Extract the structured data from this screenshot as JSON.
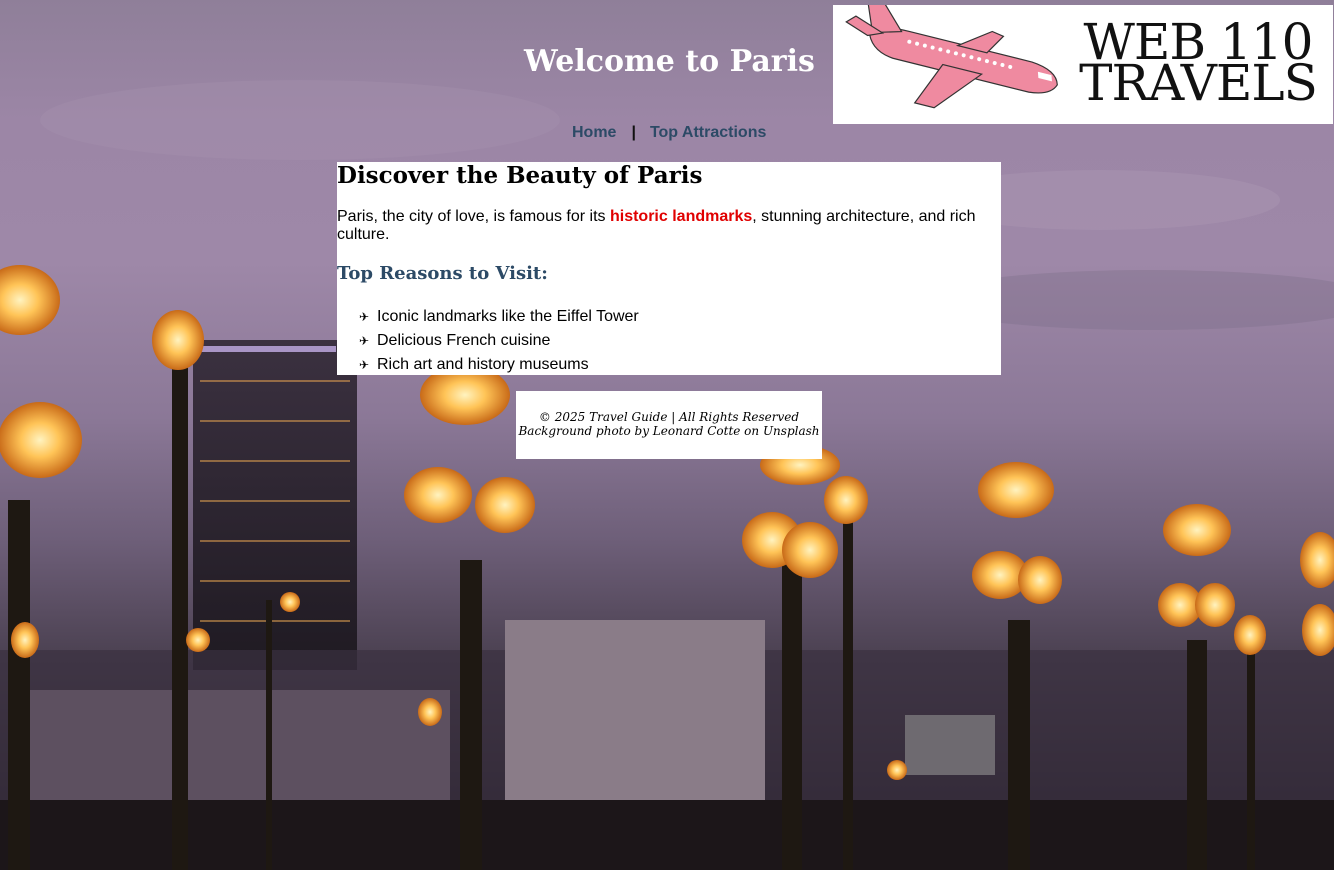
{
  "header": {
    "title": "Welcome to Paris",
    "logo": {
      "line1": "WEB 110",
      "line2": "TRAVELS",
      "plane_color": "#ef8aa0"
    }
  },
  "nav": {
    "items": [
      {
        "label": "Home"
      },
      {
        "label": "Top Attractions"
      }
    ],
    "separator": "|"
  },
  "main": {
    "heading": "Discover the Beauty of Paris",
    "intro_before": "Paris, the city of love, is famous for its ",
    "intro_highlight": "historic landmarks",
    "intro_after": ", stunning architecture, and rich culture.",
    "reasons_heading": "Top Reasons to Visit:",
    "reasons": [
      "Iconic landmarks like the Eiffel Tower",
      "Delicious French cuisine",
      "Rich art and history museums"
    ],
    "bullet_icon": "plane-icon"
  },
  "footer": {
    "copyright": "© 2025 Travel Guide | All Rights Reserved",
    "credit": "Background photo by Leonard Cotte on Unsplash"
  },
  "colors": {
    "nav_link": "#2c4a66",
    "highlight": "#e00000",
    "subheading": "#2c4a66",
    "lamp_glow": "#ffc457"
  }
}
